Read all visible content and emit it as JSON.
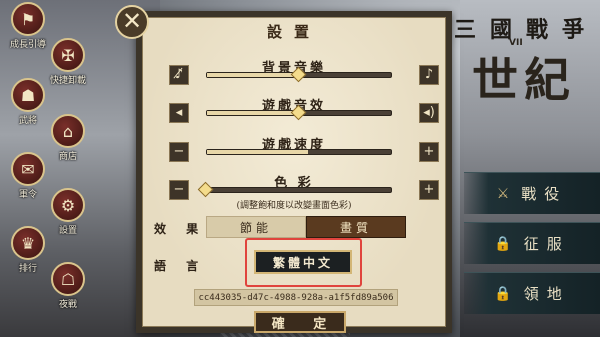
{
  "side_menu": [
    {
      "label": "成長引導",
      "icon": "banner-icon"
    },
    {
      "label": "快捷卸載",
      "icon": "tools-icon"
    },
    {
      "label": "武將",
      "icon": "general-icon"
    },
    {
      "label": "商店",
      "icon": "shop-icon"
    },
    {
      "label": "軍令",
      "icon": "letter-icon"
    },
    {
      "label": "設置",
      "icon": "gear-icon"
    },
    {
      "label": "排行",
      "icon": "crown-icon"
    },
    {
      "label": "夜戰",
      "icon": "helmet-icon"
    }
  ],
  "game_title": {
    "small": "三國戰爭",
    "big": "世紀",
    "tag": "VII"
  },
  "right_menu": [
    {
      "label": "戰役"
    },
    {
      "label": "征服"
    },
    {
      "label": "領地"
    }
  ],
  "dialog": {
    "title": "設置",
    "close_glyph": "✕",
    "music": {
      "label": "背景音樂",
      "level": 0.5
    },
    "sfx": {
      "label": "遊戲音效",
      "level": 0.5
    },
    "speed": {
      "label": "遊戲速度",
      "level": 0.55,
      "minus": "−",
      "plus": "+"
    },
    "color": {
      "label": "色 彩",
      "level": 0.0,
      "minus": "−",
      "plus": "+",
      "hint": "(調整飽和度以改變畫面色彩)"
    },
    "effect": {
      "label": "效 果",
      "options": [
        "節能",
        "畫質"
      ],
      "selected": "畫質"
    },
    "language": {
      "label": "語 言",
      "value": "繁體中文"
    },
    "device_id": "cc443035-d47c-4988-928a-a1f5fd89a506",
    "confirm": "確 定"
  },
  "colors": {
    "accent": "#5a3a1f",
    "highlight_frame": "#e0443d"
  }
}
